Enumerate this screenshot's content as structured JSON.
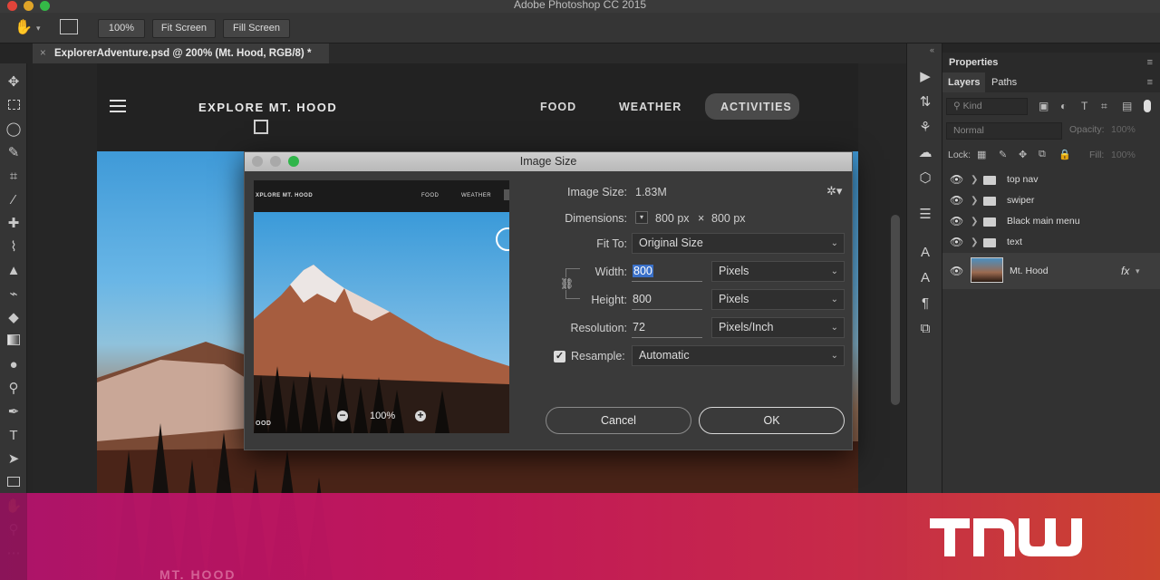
{
  "app": {
    "title": "Adobe Photoshop CC 2015"
  },
  "options_bar": {
    "zoom_value": "100%",
    "fit_screen": "Fit Screen",
    "fill_screen": "Fill Screen"
  },
  "document_tab": {
    "title": "ExplorerAdventure.psd @ 200% (Mt. Hood, RGB/8) *",
    "close_glyph": "×"
  },
  "artboard": {
    "brand": "EXPLORE MT. HOOD",
    "nav": [
      "FOOD",
      "WEATHER",
      "ACTIVITIES"
    ],
    "active_nav": "ACTIVITIES"
  },
  "dialog": {
    "title": "Image Size",
    "image_size_label": "Image Size:",
    "image_size_value": "1.83M",
    "dimensions_label": "Dimensions:",
    "dimensions_w": "800 px",
    "dimensions_x": "×",
    "dimensions_h": "800 px",
    "fit_to_label": "Fit To:",
    "fit_to_value": "Original Size",
    "width_label": "Width:",
    "width_value": "800",
    "width_unit": "Pixels",
    "height_label": "Height:",
    "height_value": "800",
    "height_unit": "Pixels",
    "resolution_label": "Resolution:",
    "resolution_value": "72",
    "resolution_unit": "Pixels/Inch",
    "resample_label": "Resample:",
    "resample_value": "Automatic",
    "resample_checked": true,
    "cancel": "Cancel",
    "ok": "OK",
    "preview": {
      "brand": "XPLORE MT. HOOD",
      "nav": [
        "FOOD",
        "WEATHER"
      ],
      "zoom": "100%",
      "bottom_text": "OOD"
    }
  },
  "panel": {
    "properties": "Properties",
    "tabs": [
      "Layers",
      "Paths"
    ],
    "kind_placeholder": "Kind",
    "blend_mode": "Normal",
    "opacity_label": "Opacity:",
    "opacity_value": "100%",
    "lock_label": "Lock:",
    "fill_label": "Fill:",
    "fill_value": "100%",
    "layers": [
      {
        "name": "top nav",
        "type": "group"
      },
      {
        "name": "swiper",
        "type": "group"
      },
      {
        "name": "Black main menu",
        "type": "group"
      },
      {
        "name": "text",
        "type": "group"
      },
      {
        "name": "Mt. Hood",
        "type": "image",
        "fx": "fx"
      }
    ]
  },
  "overlay": {
    "logo": "TNW",
    "caption": "MT. HOOD"
  },
  "colors": {
    "accent_band_start": "#b5136e",
    "accent_band_end": "#d5452e",
    "ok_border": "#d8d8d8"
  }
}
